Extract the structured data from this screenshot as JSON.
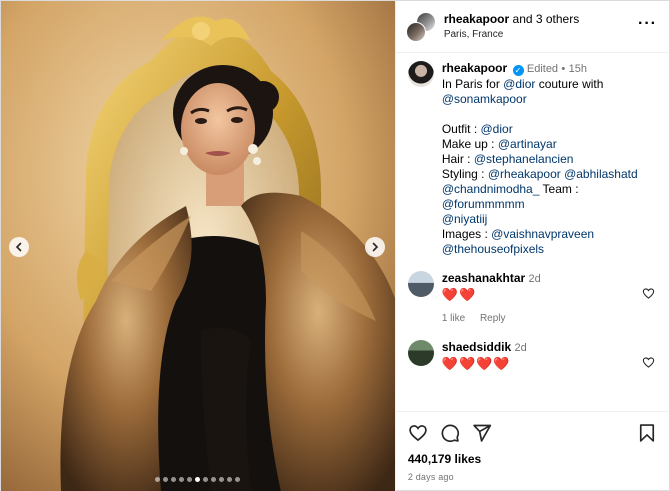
{
  "header": {
    "username": "rheakapoor",
    "and_others": "and 3 others",
    "location": "Paris, France",
    "more_icon": "more-horizontal-icon"
  },
  "caption": {
    "username": "rheakapoor",
    "verified": true,
    "edited": "Edited",
    "separator": "•",
    "time": "15h",
    "lines": [
      {
        "text": "In Paris for ",
        "tag": "@dior",
        "tail": " couture with"
      },
      {
        "text": "",
        "tag": "@sonamkapoor",
        "tail": ""
      },
      {
        "text": "",
        "tag": "",
        "tail": ""
      },
      {
        "text": "Outfit : ",
        "tag": "@dior",
        "tail": ""
      },
      {
        "text": "Make up : ",
        "tag": "@artinayar",
        "tail": ""
      },
      {
        "text": "Hair : ",
        "tag": "@stephanelancien",
        "tail": ""
      },
      {
        "text": "Styling : ",
        "tag": "@rheakapoor @abhilashatd",
        "tail": ""
      },
      {
        "text": "",
        "tag": "@chandnimodha_",
        "tail": " Team : ",
        "tag2": "@forummmmm"
      },
      {
        "text": "",
        "tag": "@niyatiij",
        "tail": ""
      },
      {
        "text": "Images : ",
        "tag": "@vaishnavpraveen",
        "tail": ""
      },
      {
        "text": "",
        "tag": "@thehouseofpixels",
        "tail": ""
      }
    ]
  },
  "comments": [
    {
      "username": "zeashanakhtar",
      "time": "2d",
      "hearts": "❤️❤️",
      "likes": "1 like",
      "reply": "Reply"
    },
    {
      "username": "shaedsiddik",
      "time": "2d",
      "hearts": "❤️❤️❤️❤️"
    }
  ],
  "actions": {
    "like_icon": "heart-icon",
    "comment_icon": "comment-icon",
    "share_icon": "send-icon",
    "save_icon": "bookmark-icon",
    "likes": "440,179 likes",
    "posted": "2 days ago"
  },
  "carousel": {
    "total_dots": 11,
    "active_index": 5,
    "prev_icon": "chevron-left-icon",
    "next_icon": "chevron-right-icon"
  },
  "colors": {
    "link": "#00376b",
    "verified": "#0095f6",
    "heart": "#ed4956",
    "muted": "#737373"
  }
}
